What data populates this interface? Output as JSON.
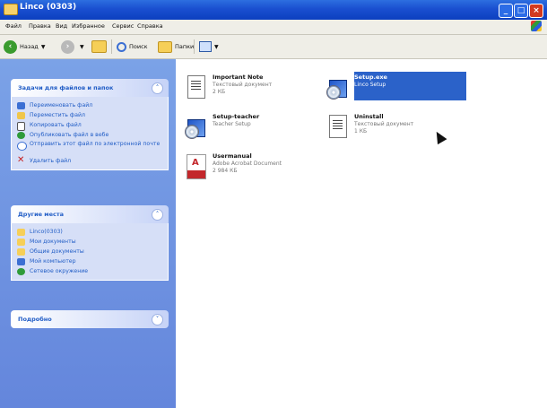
{
  "window": {
    "title": "Linco (0303)"
  },
  "menu": [
    "Файл",
    "Правка",
    "Вид",
    "Избранное",
    "Сервис",
    "Справка"
  ],
  "toolbar": {
    "back_label": "Назад",
    "search_label": "Поиск",
    "folders_label": "Папки"
  },
  "sidebar": {
    "tasks": {
      "title": "Задачи для файлов и папок",
      "items": [
        "Переименовать файл",
        "Переместить файл",
        "Копировать файл",
        "Опубликовать файл в вебе",
        "Отправить этот файл по электронной почте",
        "Удалить файл"
      ]
    },
    "places": {
      "title": "Другие места",
      "items": [
        "Linco(0303)",
        "Мои документы",
        "Общие документы",
        "Мой компьютер",
        "Сетевое окружение"
      ]
    },
    "details": {
      "title": "Подробно"
    }
  },
  "files": [
    {
      "name": "Important Note",
      "type": "Текстовый документ",
      "size": "2 КБ",
      "icon": "text-document-icon"
    },
    {
      "name": "Setup.exe",
      "type": "Linco Setup",
      "size": "",
      "icon": "setup-icon",
      "selected": true
    },
    {
      "name": "Setup-teacher",
      "type": "Teacher Setup",
      "size": "",
      "icon": "setup-icon"
    },
    {
      "name": "Uninstall",
      "type": "Текстовый документ",
      "size": "1 КБ",
      "icon": "text-document-icon"
    },
    {
      "name": "Usermanual",
      "type": "Adobe Acrobat Document",
      "size": "2 984 КБ",
      "icon": "pdf-icon"
    }
  ],
  "colors": {
    "titlebar": "#1a4fd0",
    "sidebar": "#6f93e0",
    "panel_text": "#215dc6",
    "selection": "#2b62c9"
  }
}
